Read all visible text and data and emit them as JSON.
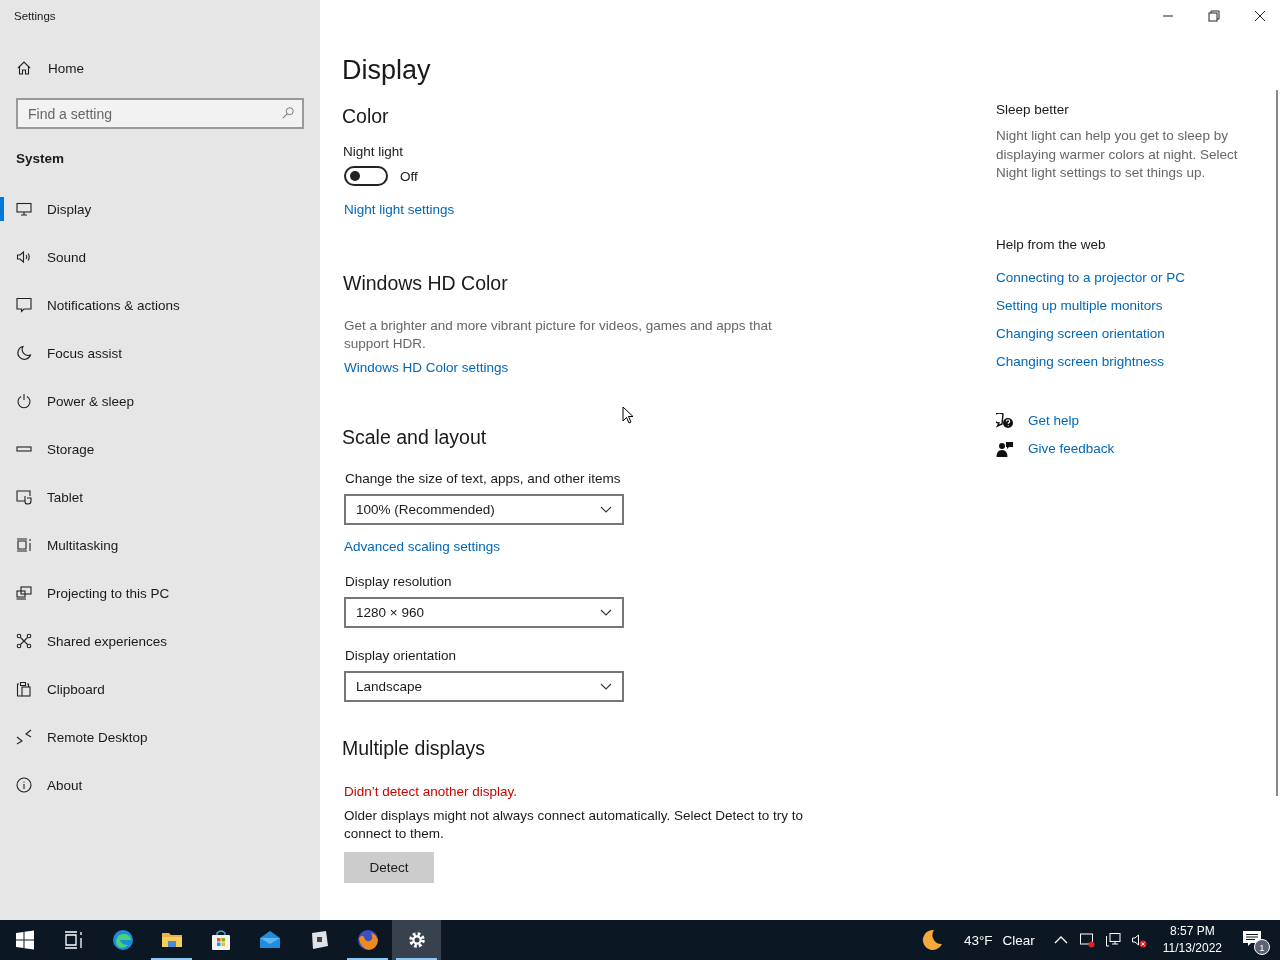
{
  "window": {
    "title": "Settings"
  },
  "sidebar": {
    "home": "Home",
    "search": {
      "placeholder": "Find a setting"
    },
    "section": "System",
    "items": [
      {
        "label": "Display",
        "selected": true
      },
      {
        "label": "Sound",
        "selected": false
      },
      {
        "label": "Notifications & actions",
        "selected": false
      },
      {
        "label": "Focus assist",
        "selected": false
      },
      {
        "label": "Power & sleep",
        "selected": false
      },
      {
        "label": "Storage",
        "selected": false
      },
      {
        "label": "Tablet",
        "selected": false
      },
      {
        "label": "Multitasking",
        "selected": false
      },
      {
        "label": "Projecting to this PC",
        "selected": false
      },
      {
        "label": "Shared experiences",
        "selected": false
      },
      {
        "label": "Clipboard",
        "selected": false
      },
      {
        "label": "Remote Desktop",
        "selected": false
      },
      {
        "label": "About",
        "selected": false
      }
    ]
  },
  "page": {
    "title": "Display",
    "color": {
      "heading": "Color",
      "night_light": {
        "label": "Night light",
        "on": false,
        "state_text": "Off"
      },
      "link": "Night light settings"
    },
    "hd_color": {
      "heading": "Windows HD Color",
      "description": "Get a brighter and more vibrant picture for videos, games and apps that support HDR.",
      "link": "Windows HD Color settings"
    },
    "scale": {
      "heading": "Scale and layout",
      "fields": [
        {
          "label": "Change the size of text, apps, and other items",
          "value": "100% (Recommended)",
          "link": "Advanced scaling settings"
        },
        {
          "label": "Display resolution",
          "value": "1280 × 960"
        },
        {
          "label": "Display orientation",
          "value": "Landscape"
        }
      ]
    },
    "multiple": {
      "heading": "Multiple displays",
      "warning": "Didn’t detect another display.",
      "description": "Older displays might not always connect automatically. Select Detect to try to connect to them.",
      "button": "Detect"
    }
  },
  "aside": {
    "sleep": {
      "heading": "Sleep better",
      "text": "Night light can help you get to sleep by displaying warmer colors at night. Select Night light settings to set things up."
    },
    "help": {
      "heading": "Help from the web",
      "links": [
        "Connecting to a projector or PC",
        "Setting up multiple monitors",
        "Changing screen orientation",
        "Changing screen brightness"
      ]
    },
    "actions": [
      "Get help",
      "Give feedback"
    ]
  },
  "taskbar": {
    "apps": [
      {
        "running": false,
        "selected": false
      },
      {
        "running": false,
        "selected": false
      },
      {
        "running": false,
        "selected": false
      },
      {
        "running": true,
        "selected": false
      },
      {
        "running": false,
        "selected": false
      },
      {
        "running": false,
        "selected": false
      },
      {
        "running": false,
        "selected": false
      },
      {
        "running": true,
        "selected": false
      },
      {
        "running": true,
        "selected": true
      }
    ],
    "weather": {
      "temperature": "43°F",
      "condition": "Clear"
    },
    "time": "8:57 PM",
    "date": "11/13/2022",
    "notifications": "1"
  }
}
